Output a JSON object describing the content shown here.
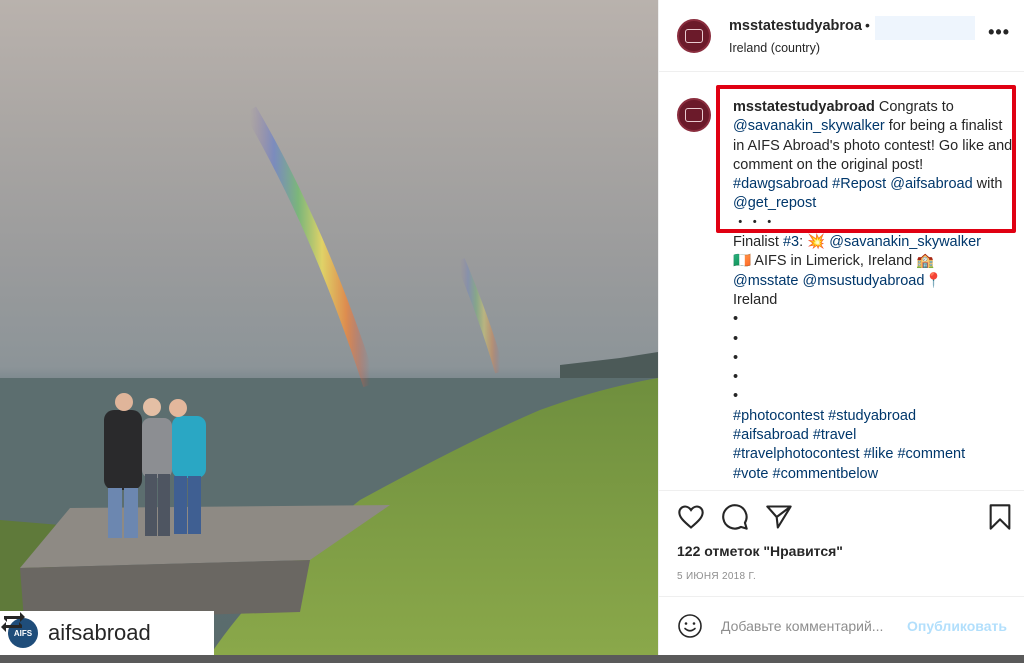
{
  "post": {
    "username": "msstatestudyabroa",
    "dot": "•",
    "location": "Ireland (country)",
    "more_icon": "•••"
  },
  "photo": {
    "repost_handle": "aifsabroad",
    "aifs_logo_text": "AIFS"
  },
  "caption": {
    "author": "msstatestudyabroad",
    "text1": " Congrats to ",
    "mention1": "@savanakin_skywalker",
    "text2": " for being a finalist in AIFS Abroad's photo contest! Go like and comment on the original post! ",
    "tag1": "#dawgsabroad",
    "tag2": "#Repost",
    "mention2": "@aifsabroad",
    "text3": " with ",
    "mention3": "@get_repost",
    "dots_line": "・・・",
    "finalist_text": "Finalist ",
    "tag3": "#3",
    "colon": ": 💥 ",
    "mention4": "@savanakin_skywalker",
    "line2_text": "🇮🇪 AIFS in Limerick, Ireland 🏫",
    "mention5": "@msstate",
    "mention6": "@msustudyabroad",
    "pin": "📍",
    "ireland": "Ireland",
    "bullets": [
      "•",
      "•",
      "•",
      "•",
      "•"
    ],
    "hashtags": [
      "#photocontest",
      "#studyabroad",
      "#aifsabroad",
      "#travel",
      "#travelphotocontest",
      "#like",
      "#comment",
      "#vote",
      "#commentbelow"
    ]
  },
  "stats": {
    "likes": "122 отметок \"Нравится\"",
    "date": "5 ИЮНЯ 2018 Г."
  },
  "comment": {
    "placeholder": "Добавьте комментарий...",
    "publish_label": "Опубликовать"
  },
  "icons": {
    "like": "heart-icon",
    "comment": "comment-icon",
    "share": "share-icon",
    "save": "bookmark-icon",
    "emoji": "emoji-icon",
    "repost": "repost-icon"
  },
  "colors": {
    "link": "#00376b",
    "highlight": "#e00012",
    "avatar": "#6b1a2a",
    "publish": "#b2dffc"
  }
}
